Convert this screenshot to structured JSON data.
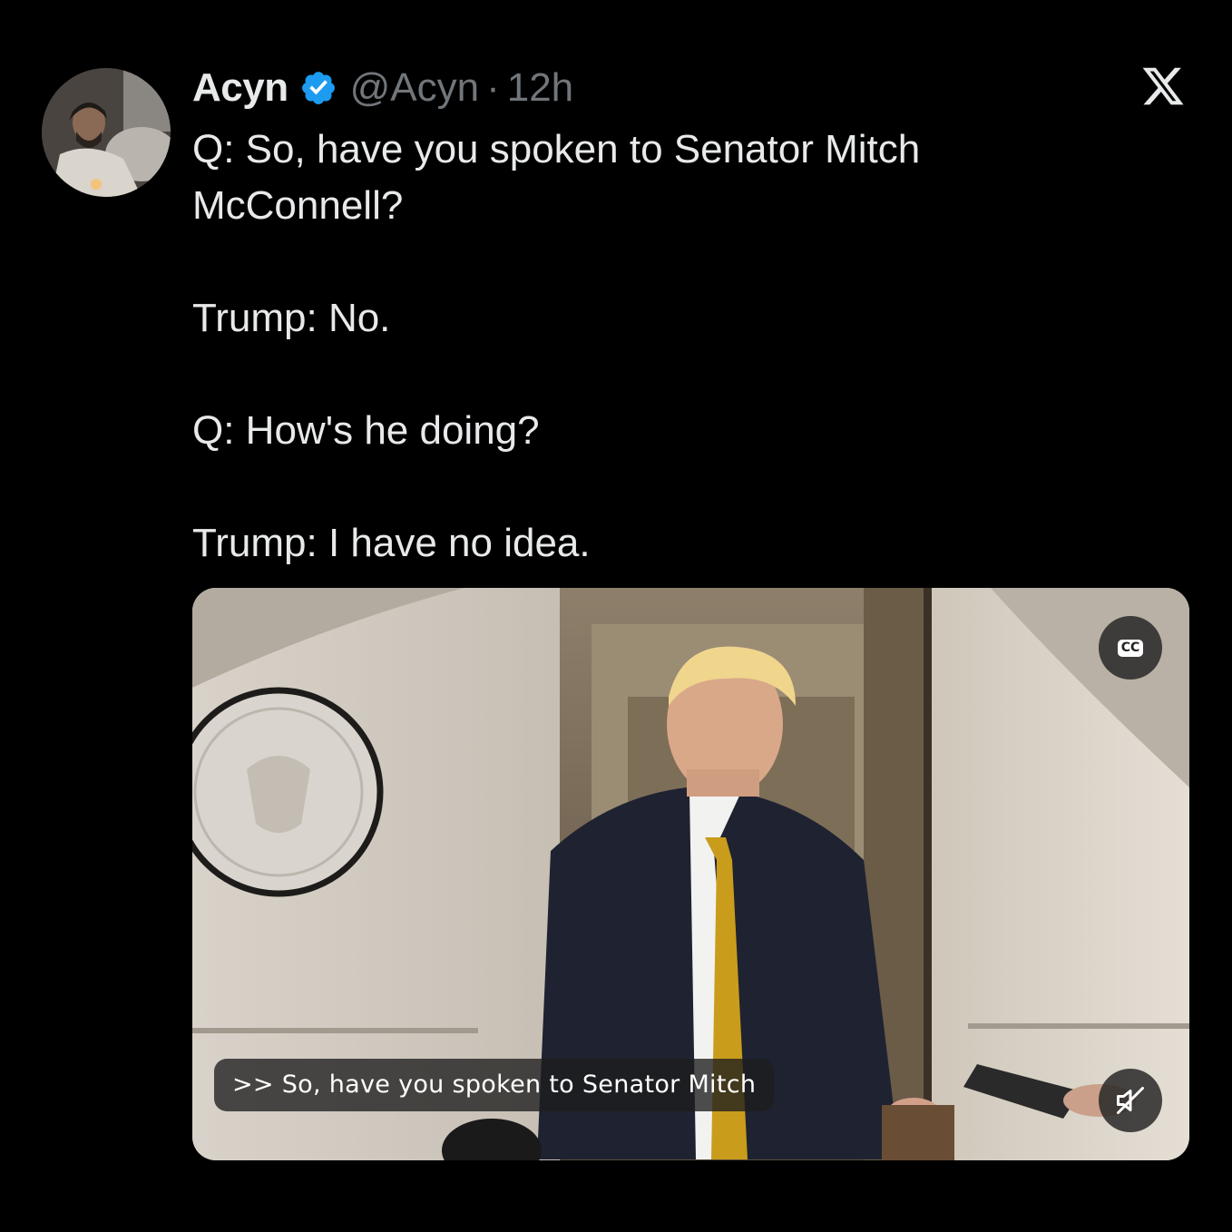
{
  "tweet": {
    "author": {
      "display_name": "Acyn",
      "handle": "@Acyn",
      "separator": "·",
      "time": "12h",
      "verified_icon": "verified-badge-icon"
    },
    "lines": [
      "Q: So, have you spoken to Senator Mitch McConnell?",
      "Trump: No.",
      "Q: How's he doing?",
      "Trump: I have no idea."
    ]
  },
  "video": {
    "caption": ">> So, have you spoken to Senator Mitch",
    "cc_label": "CC",
    "mute_icon": "muted-speaker-icon"
  },
  "brand": {
    "logo": "x-logo-icon"
  },
  "colors": {
    "background": "#000000",
    "text": "#e7e9ea",
    "secondary_text": "#71767b",
    "verified_blue": "#1d9bf0"
  }
}
